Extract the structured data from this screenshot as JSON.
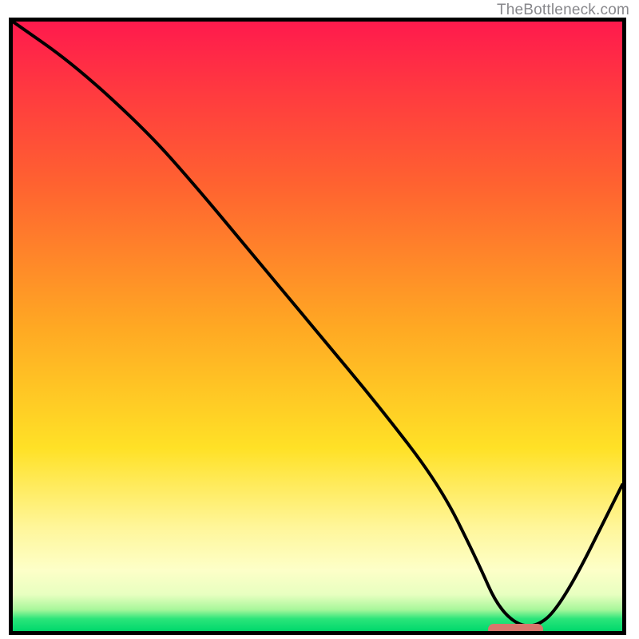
{
  "watermark": "TheBottleneck.com",
  "chart_data": {
    "type": "line",
    "title": "",
    "xlabel": "",
    "ylabel": "",
    "xlim": [
      0,
      100
    ],
    "ylim": [
      0,
      100
    ],
    "series": [
      {
        "name": "curve",
        "x": [
          0,
          10,
          22,
          30,
          40,
          50,
          60,
          70,
          76,
          80,
          85,
          90,
          100
        ],
        "y": [
          100,
          93,
          82,
          73,
          61,
          49,
          37,
          24,
          12,
          3,
          0,
          4,
          24
        ]
      }
    ],
    "marker": {
      "name": "optimal-range",
      "x_start": 78,
      "x_end": 87,
      "y": 0
    },
    "background": {
      "type": "vertical-gradient",
      "stops": [
        {
          "pos": 0,
          "color": "#ff1a4d"
        },
        {
          "pos": 50,
          "color": "#ffa823"
        },
        {
          "pos": 83,
          "color": "#fff69a"
        },
        {
          "pos": 100,
          "color": "#00d86c"
        }
      ]
    }
  }
}
